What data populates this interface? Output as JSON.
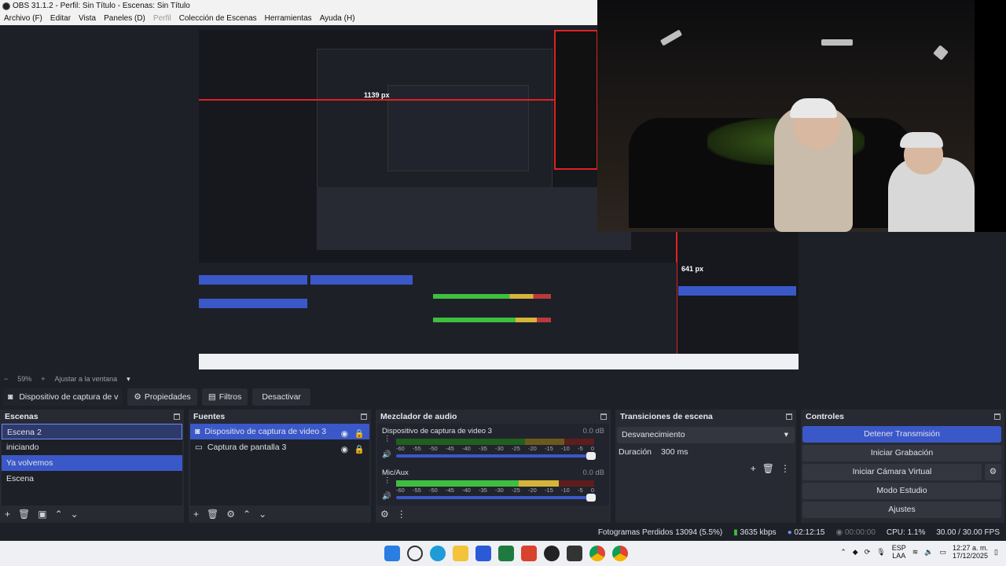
{
  "window": {
    "title": "OBS 31.1.2 - Perfil: Sin Título - Escenas: Sin Título"
  },
  "menu": [
    "Archivo (F)",
    "Editar",
    "Vista",
    "Paneles (D)",
    "Perfil",
    "Colección de Escenas",
    "Herramientas",
    "Ayuda (H)"
  ],
  "preview": {
    "measure_h": "1139 px",
    "measure_v": "641 px"
  },
  "zoom": {
    "level": "59%",
    "fit_label": "Ajustar a la ventana"
  },
  "source_toolbar": {
    "source": "Dispositivo de captura de v",
    "properties": "Propiedades",
    "filters": "Filtros",
    "deactivate": "Desactivar"
  },
  "scenes": {
    "title": "Escenas",
    "items": [
      "Escena 2",
      "iniciando",
      "Ya volvemos",
      "Escena"
    ]
  },
  "sources": {
    "title": "Fuentes",
    "items": [
      "Dispositivo de captura de video 3",
      "Captura de pantalla 3"
    ]
  },
  "mixer": {
    "title": "Mezclador de audio",
    "tracks": [
      {
        "name": "Dispositivo de captura de video 3",
        "db": "0.0 dB",
        "level": 0.0
      },
      {
        "name": "Mic/Aux",
        "db": "0.0 dB",
        "level": 0.82
      }
    ],
    "scale": [
      "-60",
      "-55",
      "-50",
      "-45",
      "-40",
      "-35",
      "-30",
      "-25",
      "-20",
      "-15",
      "-10",
      "-5",
      "0"
    ]
  },
  "transitions": {
    "title": "Transiciones de escena",
    "type": "Desvanecimiento",
    "duration_label": "Duración",
    "duration": "300 ms"
  },
  "controls": {
    "title": "Controles",
    "stop_stream": "Detener Transmisión",
    "start_record": "Iniciar Grabación",
    "virtual_cam": "Iniciar Cámara Virtual",
    "studio": "Modo Estudio",
    "settings": "Ajustes"
  },
  "status": {
    "dropped": "Fotogramas Perdidos 13094 (5.5%)",
    "bitrate": "3635 kbps",
    "stream_time": "02:12:15",
    "rec_time": "00:00:00",
    "cpu": "CPU: 1.1%",
    "fps": "30.00 / 30.00 FPS"
  },
  "taskbar": {
    "lang": "ESP",
    "lang2": "LAA",
    "time": "12:27 a. m.",
    "date": "17/12/2025"
  },
  "colors": {
    "accent": "#3b58c9",
    "dock": "#272a33",
    "bg": "#1e2028"
  }
}
